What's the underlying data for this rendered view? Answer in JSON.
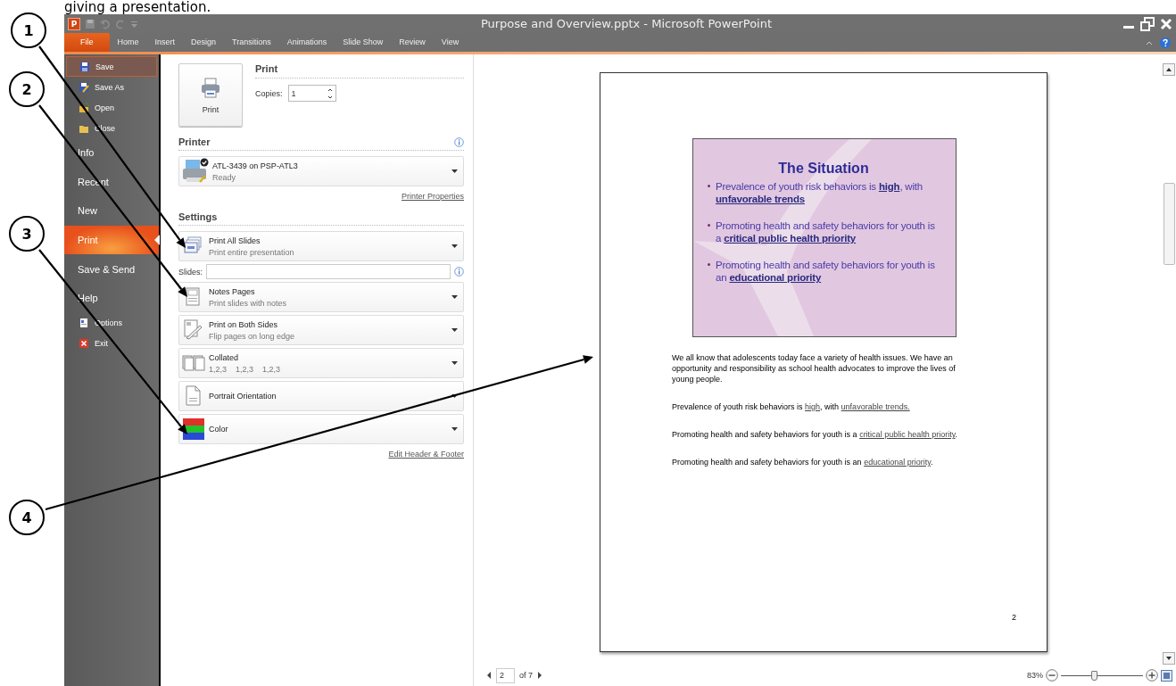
{
  "caption": "giving a presentation.",
  "window": {
    "title": "Purpose and Overview.pptx - Microsoft PowerPoint",
    "app_icon_letter": "P"
  },
  "ribbon_tabs": [
    {
      "label": "File",
      "selected": true
    },
    {
      "label": "Home",
      "selected": false
    },
    {
      "label": "Insert",
      "selected": false
    },
    {
      "label": "Design",
      "selected": false
    },
    {
      "label": "Transitions",
      "selected": false
    },
    {
      "label": "Animations",
      "selected": false
    },
    {
      "label": "Slide Show",
      "selected": false
    },
    {
      "label": "Review",
      "selected": false
    },
    {
      "label": "View",
      "selected": false
    }
  ],
  "sidebar": {
    "items": [
      {
        "label": "Save",
        "kind": "command",
        "selected": false,
        "focused": true
      },
      {
        "label": "Save As",
        "kind": "command",
        "selected": false,
        "focused": false
      },
      {
        "label": "Open",
        "kind": "command",
        "selected": false,
        "focused": false
      },
      {
        "label": "Close",
        "kind": "command",
        "selected": false,
        "focused": false
      },
      {
        "label": "Info",
        "kind": "section",
        "selected": false,
        "focused": false
      },
      {
        "label": "Recent",
        "kind": "section",
        "selected": false,
        "focused": false
      },
      {
        "label": "New",
        "kind": "section",
        "selected": false,
        "focused": false
      },
      {
        "label": "Print",
        "kind": "section",
        "selected": true,
        "focused": false
      },
      {
        "label": "Save & Send",
        "kind": "section",
        "selected": false,
        "focused": false
      },
      {
        "label": "Help",
        "kind": "section",
        "selected": false,
        "focused": false
      },
      {
        "label": "Options",
        "kind": "command",
        "selected": false,
        "focused": false
      },
      {
        "label": "Exit",
        "kind": "command",
        "selected": false,
        "focused": false
      }
    ]
  },
  "print_panel": {
    "print_button": "Print",
    "heading": "Print",
    "copies_label": "Copies:",
    "copies_value": "1",
    "printer": {
      "heading": "Printer",
      "name": "ATL-3439 on PSP-ATL3",
      "status": "Ready",
      "properties_link": "Printer Properties"
    },
    "settings": {
      "heading": "Settings",
      "slides_label": "Slides:",
      "options": [
        {
          "title": "Print All Slides",
          "subtitle": "Print entire presentation"
        },
        {
          "title": "Notes Pages",
          "subtitle": "Print slides with notes"
        },
        {
          "title": "Print on Both Sides",
          "subtitle": "Flip pages on long edge"
        },
        {
          "title": "Collated",
          "subtitle": "1,2,3    1,2,3    1,2,3"
        },
        {
          "title": "Portrait Orientation"
        },
        {
          "title": "Color"
        }
      ],
      "footer_link": "Edit Header & Footer"
    }
  },
  "preview": {
    "slide": {
      "title": "The Situation",
      "bullets": [
        [
          {
            "text": "Prevalence of youth risk behaviors is ",
            "emphasis": false
          },
          {
            "text": "high",
            "emphasis": true
          },
          {
            "text": ", with ",
            "emphasis": false
          },
          {
            "text": "unfavorable trends",
            "emphasis": true
          }
        ],
        [
          {
            "text": "Promoting health and safety behaviors for youth is a ",
            "emphasis": false
          },
          {
            "text": "critical public health priority",
            "emphasis": true
          }
        ],
        [
          {
            "text": "Promoting health and safety behaviors for youth is an ",
            "emphasis": false
          },
          {
            "text": "educational priority",
            "emphasis": true
          }
        ]
      ]
    },
    "notes": [
      [
        {
          "text": "We all know that adolescents today face a variety of health issues.  We have an opportunity and responsibility as school health advocates to improve the lives of young people.",
          "underline": false
        }
      ],
      [
        {
          "text": "Prevalence of youth risk behaviors is ",
          "underline": false
        },
        {
          "text": "high",
          "underline": true
        },
        {
          "text": ", with ",
          "underline": false
        },
        {
          "text": "unfavorable trends.",
          "underline": true
        }
      ],
      [
        {
          "text": "Promoting health and safety behaviors for youth is a ",
          "underline": false
        },
        {
          "text": "critical public health priority",
          "underline": true
        },
        {
          "text": ".",
          "underline": false
        }
      ],
      [
        {
          "text": "Promoting health and safety behaviors for youth is an ",
          "underline": false
        },
        {
          "text": "educational priority",
          "underline": true
        },
        {
          "text": ".",
          "underline": false
        }
      ]
    ],
    "page_number": "2"
  },
  "status_bar": {
    "page_value": "2",
    "page_total": "of 7",
    "zoom": {
      "reading": "83%",
      "level": 0.4
    }
  },
  "callouts": [
    {
      "number": "1"
    },
    {
      "number": "2"
    },
    {
      "number": "3"
    },
    {
      "number": "4"
    }
  ]
}
